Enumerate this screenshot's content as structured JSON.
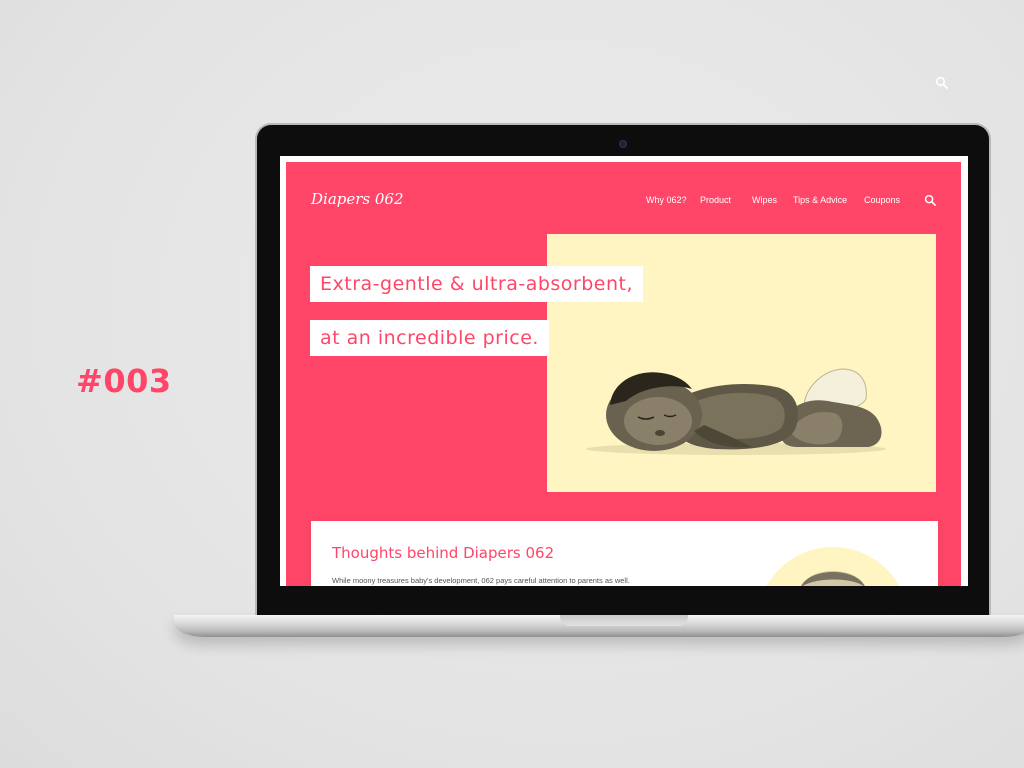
{
  "label": "#003",
  "colors": {
    "brand": "#ff4668",
    "cream": "#fff5c2",
    "white": "#ffffff"
  },
  "site": {
    "logo": "Diapers 062",
    "nav": [
      "Why 062?",
      "Product",
      "Wipes",
      "Tips & Advice",
      "Coupons"
    ],
    "search_icon": "search-icon",
    "hero": {
      "line1": "Extra-gentle & ultra-absorbent,",
      "line2": "at an incredible price."
    },
    "section": {
      "title": "Thoughts behind Diapers 062",
      "text": "While moony treasures baby's development, 062 pays careful attention to parents as well."
    }
  }
}
